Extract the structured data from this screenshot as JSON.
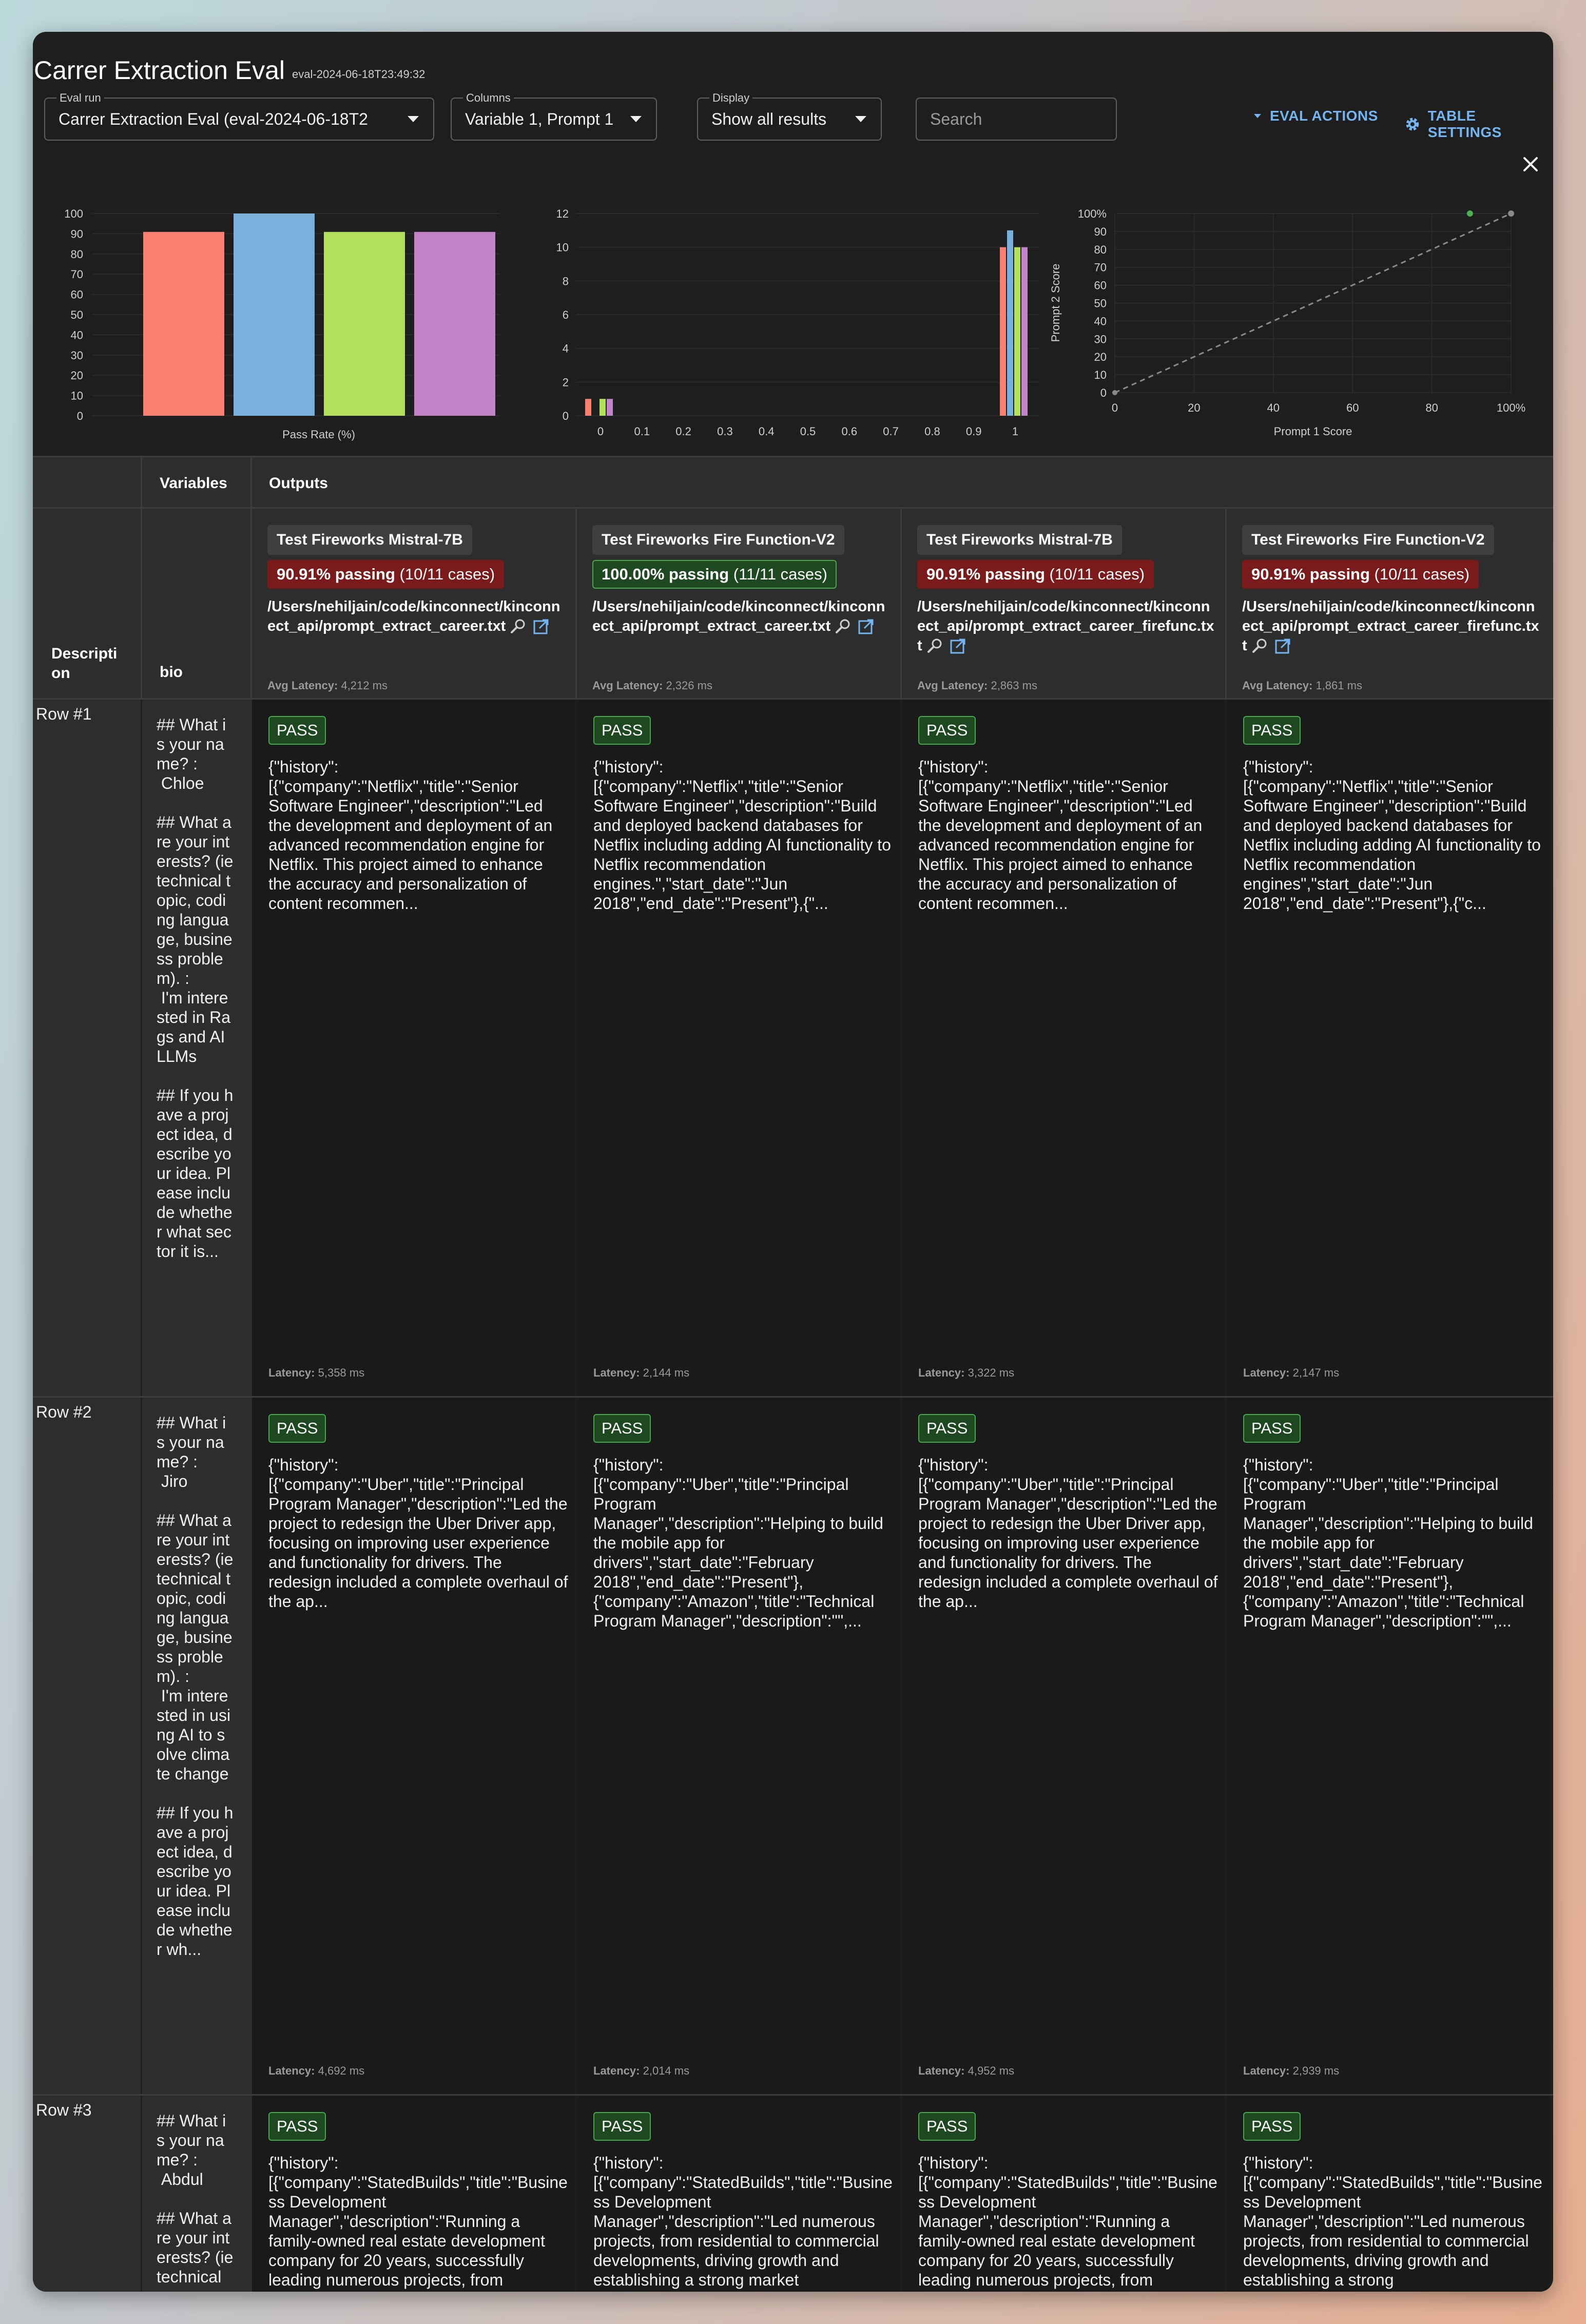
{
  "header": {
    "title": "Carrer Extraction Eval",
    "eval_id": "eval-2024-06-18T23:49:32"
  },
  "controls": {
    "eval_run": {
      "label": "Eval run",
      "value": "Carrer Extraction Eval (eval-2024-06-18T2"
    },
    "columns": {
      "label": "Columns",
      "value": "Variable 1, Prompt 1"
    },
    "display": {
      "label": "Display",
      "value": "Show all results"
    },
    "search_placeholder": "Search",
    "eval_actions": "EVAL ACTIONS",
    "table_settings": "TABLE SETTINGS"
  },
  "chart_data": [
    {
      "type": "bar",
      "xlabel": "Pass Rate (%)",
      "ylim": [
        0,
        100
      ],
      "yticks": [
        0,
        10,
        20,
        30,
        40,
        50,
        60,
        70,
        80,
        90,
        100
      ],
      "series": [
        {
          "color": "#fa8072",
          "value": 90.91
        },
        {
          "color": "#7ab0dc",
          "value": 100
        },
        {
          "color": "#b2e05c",
          "value": 90.91
        },
        {
          "color": "#c283c9",
          "value": 90.91
        }
      ]
    },
    {
      "type": "bar",
      "xticks": [
        "0",
        "0.1",
        "0.2",
        "0.3",
        "0.4",
        "0.5",
        "0.6",
        "0.7",
        "0.8",
        "0.9",
        "1"
      ],
      "ylim": [
        0,
        12
      ],
      "yticks": [
        0,
        2,
        4,
        6,
        8,
        10,
        12
      ],
      "groups": [
        {
          "x": 0,
          "values": [
            1,
            0,
            1,
            1
          ]
        },
        {
          "x": 1,
          "values": [
            10,
            11,
            10,
            10
          ]
        }
      ],
      "colors": [
        "#fa8072",
        "#7ab0dc",
        "#b2e05c",
        "#c283c9"
      ]
    },
    {
      "type": "scatter",
      "xlabel": "Prompt 1 Score",
      "ylabel": "Prompt 2 Score",
      "xticks": [
        "0",
        "20",
        "40",
        "60",
        "80",
        "100%"
      ],
      "yticks": [
        "0",
        "10",
        "20",
        "30",
        "40",
        "50",
        "60",
        "70",
        "80",
        "90",
        "100%"
      ],
      "points": [
        {
          "x": 90.91,
          "y": 100
        }
      ],
      "diagonal": true
    }
  ],
  "table": {
    "header": {
      "variables": "Variables",
      "outputs": "Outputs",
      "description": "Description",
      "bio": "bio"
    },
    "columns": [
      {
        "provider": "Test Fireworks Mistral-7B",
        "pass_pct": "90.91% passing",
        "pass_count": "(10/11 cases)",
        "status": "red",
        "prompt": "/Users/nehiljain/code/kinconnect/kinconnect_api/prompt_extract_career.txt",
        "avg_latency_label": "Avg Latency:",
        "avg_latency": "4,212 ms"
      },
      {
        "provider": "Test Fireworks Fire Function-V2",
        "pass_pct": "100.00% passing",
        "pass_count": "(11/11 cases)",
        "status": "green",
        "prompt": "/Users/nehiljain/code/kinconnect/kinconnect_api/prompt_extract_career.txt",
        "avg_latency_label": "Avg Latency:",
        "avg_latency": "2,326 ms"
      },
      {
        "provider": "Test Fireworks Mistral-7B",
        "pass_pct": "90.91% passing",
        "pass_count": "(10/11 cases)",
        "status": "red",
        "prompt": "/Users/nehiljain/code/kinconnect/kinconnect_api/prompt_extract_career_firefunc.txt",
        "avg_latency_label": "Avg Latency:",
        "avg_latency": "2,863 ms"
      },
      {
        "provider": "Test Fireworks Fire Function-V2",
        "pass_pct": "90.91% passing",
        "pass_count": "(10/11 cases)",
        "status": "red",
        "prompt": "/Users/nehiljain/code/kinconnect/kinconnect_api/prompt_extract_career_firefunc.txt",
        "avg_latency_label": "Avg Latency:",
        "avg_latency": "1,861 ms"
      }
    ],
    "rows": [
      {
        "label": "Row #1",
        "bio": "## What is your name? :\n Chloe\n\n## What are your interests? (ie technical topic, coding language, business problem). :\n I'm interested in Rags and AI LLMs\n\n## If you have a project idea, describe your idea. Please include whether what sector it is...",
        "outputs": [
          {
            "result": "PASS",
            "text": "{\"history\":[{\"company\":\"Netflix\",\"title\":\"Senior Software Engineer\",\"description\":\"Led the development and deployment of an advanced recommendation engine for Netflix. This project aimed to enhance the accuracy and personalization of content recommen...",
            "latency_label": "Latency:",
            "latency": "5,358 ms"
          },
          {
            "result": "PASS",
            "text": "{\"history\":[{\"company\":\"Netflix\",\"title\":\"Senior Software Engineer\",\"description\":\"Build and deployed backend databases for Netflix including adding AI functionality to Netflix recommendation engines.\",\"start_date\":\"Jun 2018\",\"end_date\":\"Present\"},{\"...",
            "latency_label": "Latency:",
            "latency": "2,144 ms"
          },
          {
            "result": "PASS",
            "text": "{\"history\":[{\"company\":\"Netflix\",\"title\":\"Senior Software Engineer\",\"description\":\"Led the development and deployment of an advanced recommendation engine for Netflix. This project aimed to enhance the accuracy and personalization of content recommen...",
            "latency_label": "Latency:",
            "latency": "3,322 ms"
          },
          {
            "result": "PASS",
            "text": "{\"history\":[{\"company\":\"Netflix\",\"title\":\"Senior Software Engineer\",\"description\":\"Build and deployed backend databases for Netflix including adding AI functionality to Netflix recommendation engines\",\"start_date\":\"Jun 2018\",\"end_date\":\"Present\"},{\"c...",
            "latency_label": "Latency:",
            "latency": "2,147 ms"
          }
        ]
      },
      {
        "label": "Row #2",
        "bio": "## What is your name? :\n Jiro\n\n## What are your interests? (ie technical topic, coding language, business problem). :\n I'm interested in using AI to solve climate change\n\n## If you have a project idea, describe your idea. Please include whether wh...",
        "outputs": [
          {
            "result": "PASS",
            "text": "{\"history\":[{\"company\":\"Uber\",\"title\":\"Principal Program Manager\",\"description\":\"Led the project to redesign the Uber Driver app, focusing on improving user experience and functionality for drivers. The redesign included a complete overhaul of the ap...",
            "latency_label": "Latency:",
            "latency": "4,692 ms"
          },
          {
            "result": "PASS",
            "text": "{\"history\":[{\"company\":\"Uber\",\"title\":\"Principal Program Manager\",\"description\":\"Helping to build the mobile app for drivers\",\"start_date\":\"February 2018\",\"end_date\":\"Present\"},{\"company\":\"Amazon\",\"title\":\"Technical Program Manager\",\"description\":\"\",...",
            "latency_label": "Latency:",
            "latency": "2,014 ms"
          },
          {
            "result": "PASS",
            "text": "{\"history\":[{\"company\":\"Uber\",\"title\":\"Principal Program Manager\",\"description\":\"Led the project to redesign the Uber Driver app, focusing on improving user experience and functionality for drivers. The redesign included a complete overhaul of the ap...",
            "latency_label": "Latency:",
            "latency": "4,952 ms"
          },
          {
            "result": "PASS",
            "text": "{\"history\":[{\"company\":\"Uber\",\"title\":\"Principal Program Manager\",\"description\":\"Helping to build the mobile app for drivers\",\"start_date\":\"February 2018\",\"end_date\":\"Present\"},{\"company\":\"Amazon\",\"title\":\"Technical Program Manager\",\"description\":\"\",...",
            "latency_label": "Latency:",
            "latency": "2,939 ms"
          }
        ]
      },
      {
        "label": "Row #3",
        "bio": "## What is your name? :\n Abdul\n\n## What are your interests? (ie technical",
        "outputs": [
          {
            "result": "PASS",
            "text": "{\"history\":[{\"company\":\"StatedBuilds\",\"title\":\"Business Development Manager\",\"description\":\"Running a family-owned real estate development company for 20 years, successfully leading numerous projects, from",
            "latency_label": "",
            "latency": ""
          },
          {
            "result": "PASS",
            "text": "{\"history\":[{\"company\":\"StatedBuilds\",\"title\":\"Business Development Manager\",\"description\":\"Led numerous projects, from residential to commercial developments, driving growth and establishing a strong market",
            "latency_label": "",
            "latency": ""
          },
          {
            "result": "PASS",
            "text": "{\"history\":[{\"company\":\"StatedBuilds\",\"title\":\"Business Development Manager\",\"description\":\"Running a family-owned real estate development company for 20 years, successfully leading numerous projects, from",
            "latency_label": "",
            "latency": ""
          },
          {
            "result": "PASS",
            "text": "{\"history\":[{\"company\":\"StatedBuilds\",\"title\":\"Business Development Manager\",\"description\":\"Led numerous projects, from residential to commercial developments, driving growth and establishing a strong",
            "latency_label": "",
            "latency": ""
          }
        ]
      }
    ]
  }
}
